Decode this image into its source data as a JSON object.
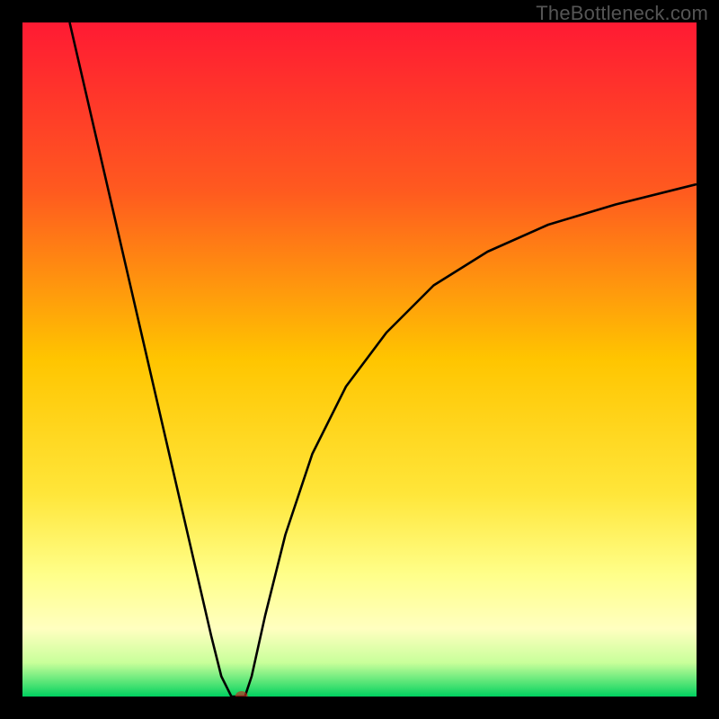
{
  "watermark": "TheBottleneck.com",
  "chart_data": {
    "type": "line",
    "title": "",
    "xlabel": "",
    "ylabel": "",
    "xlim": [
      0,
      100
    ],
    "ylim": [
      0,
      100
    ],
    "series": [
      {
        "name": "bottleneck-curve",
        "x": [
          7,
          10,
          13,
          16,
          19,
          22,
          25,
          28,
          29.5,
          31,
          32,
          33,
          34,
          36,
          39,
          43,
          48,
          54,
          61,
          69,
          78,
          88,
          100
        ],
        "y": [
          100,
          87,
          74,
          61,
          48,
          35,
          22,
          9,
          3,
          0,
          0,
          0,
          3,
          12,
          24,
          36,
          46,
          54,
          61,
          66,
          70,
          73,
          76
        ]
      }
    ],
    "marker": {
      "x": 32.5,
      "y": 0,
      "color": "#c8281e"
    },
    "gradient_stops": [
      {
        "offset": 0,
        "color": "#ff1a33"
      },
      {
        "offset": 0.25,
        "color": "#ff5a1f"
      },
      {
        "offset": 0.5,
        "color": "#ffc500"
      },
      {
        "offset": 0.7,
        "color": "#ffe63a"
      },
      {
        "offset": 0.82,
        "color": "#ffff8a"
      },
      {
        "offset": 0.9,
        "color": "#ffffc0"
      },
      {
        "offset": 0.95,
        "color": "#c8ff9a"
      },
      {
        "offset": 0.985,
        "color": "#40e070"
      },
      {
        "offset": 1.0,
        "color": "#00d060"
      }
    ]
  }
}
